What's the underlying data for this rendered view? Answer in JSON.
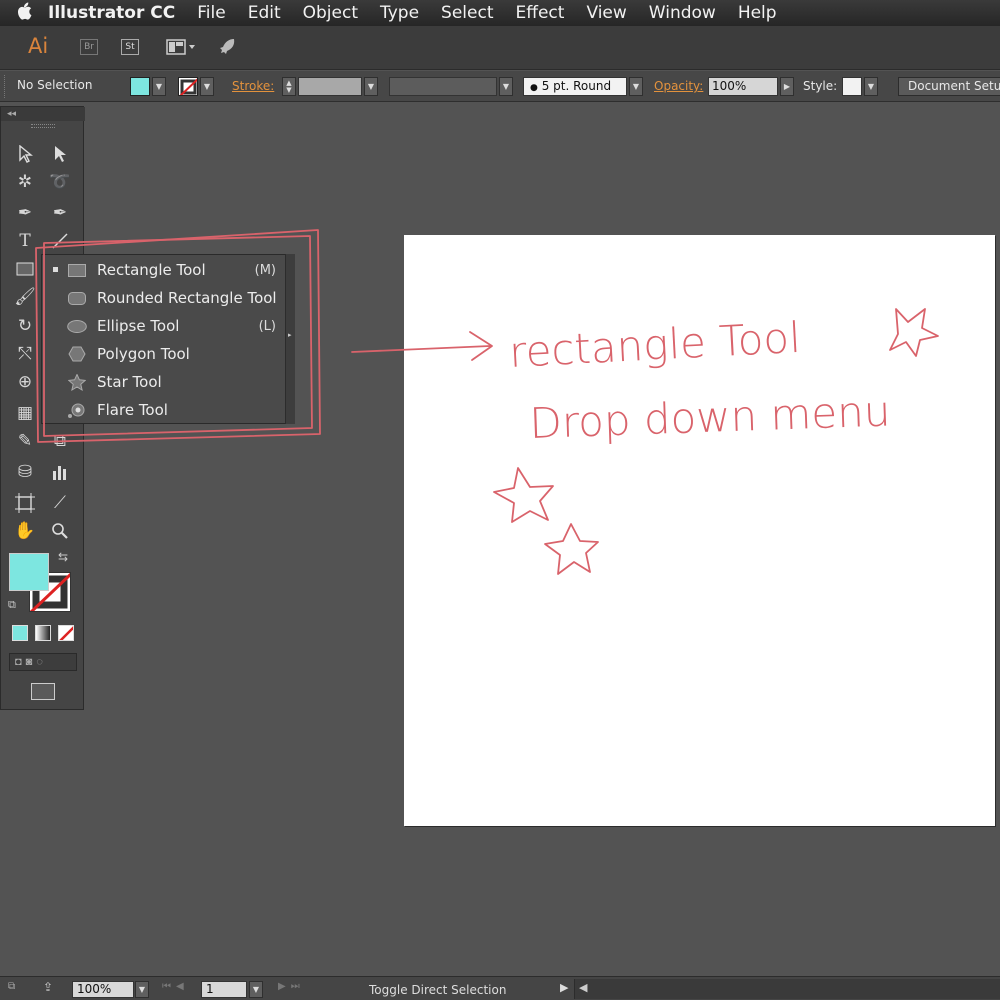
{
  "menubar": {
    "apple": "",
    "app_name": "Illustrator CC",
    "items": [
      "File",
      "Edit",
      "Object",
      "Type",
      "Select",
      "Effect",
      "View",
      "Window",
      "Help"
    ]
  },
  "appbar": {
    "logo": "Ai",
    "bridge_label": "Br",
    "stock_label": "St"
  },
  "controlbar": {
    "selection_status": "No Selection",
    "fill_color": "#7de6e0",
    "stroke_label": "Stroke:",
    "brush_value": "5 pt. Round",
    "opacity_label": "Opacity:",
    "opacity_value": "100%",
    "style_label": "Style:",
    "document_setup_label": "Document Setup"
  },
  "flyout": {
    "items": [
      {
        "label": "Rectangle Tool",
        "shortcut": "(M)",
        "icon": "rectangle-icon"
      },
      {
        "label": "Rounded Rectangle Tool",
        "shortcut": "",
        "icon": "rounded-rectangle-icon"
      },
      {
        "label": "Ellipse Tool",
        "shortcut": "(L)",
        "icon": "ellipse-icon"
      },
      {
        "label": "Polygon Tool",
        "shortcut": "",
        "icon": "polygon-icon"
      },
      {
        "label": "Star Tool",
        "shortcut": "",
        "icon": "star-icon"
      },
      {
        "label": "Flare Tool",
        "shortcut": "",
        "icon": "flare-icon"
      }
    ]
  },
  "annotation": {
    "line1": "rectangle Tool",
    "line2": "Drop down menu",
    "color": "#d9636b"
  },
  "statusbar": {
    "zoom": "100%",
    "page": "1",
    "status_text": "Toggle Direct Selection"
  },
  "colors": {
    "fill": "#7de6e0",
    "accent": "#e3923d"
  }
}
